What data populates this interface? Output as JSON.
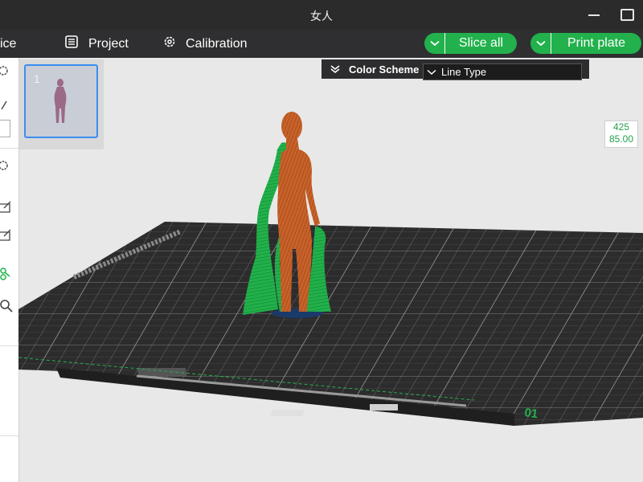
{
  "window": {
    "title": "女人"
  },
  "toolbar": {
    "slice_tab_partial": "ice",
    "project_label": "Project",
    "calibration_label": "Calibration",
    "slice_all_label": "Slice all",
    "print_plate_label": "Print plate"
  },
  "plates": [
    {
      "number": "1"
    }
  ],
  "color_scheme": {
    "label": "Color Scheme",
    "value": "Line Type"
  },
  "layer_readout": {
    "layer": "425",
    "height": "85.00"
  },
  "bed": {
    "plate_id": "01"
  },
  "colors": {
    "accent_green": "#22b14c",
    "toolpath_green": "#1fa52c",
    "toolpath_orange": "#c8622a",
    "bed_dark": "#2c2c2c"
  },
  "icons": [
    "project-icon",
    "calibration-icon",
    "chevron-down-icon",
    "collapse-icon"
  ]
}
